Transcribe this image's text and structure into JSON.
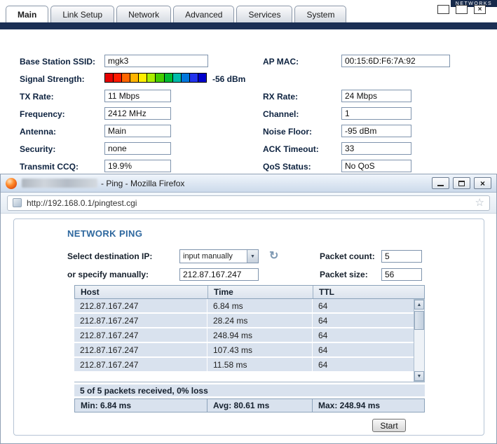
{
  "brand": {
    "logo_text": "NETWORKS"
  },
  "tabs": [
    {
      "label": "Main",
      "active": true
    },
    {
      "label": "Link Setup"
    },
    {
      "label": "Network"
    },
    {
      "label": "Advanced"
    },
    {
      "label": "Services"
    },
    {
      "label": "System"
    }
  ],
  "status": {
    "ssid": {
      "label": "Base Station SSID:",
      "value": "mgk3"
    },
    "ap_mac": {
      "label": "AP MAC:",
      "value": "00:15:6D:F6:7A:92"
    },
    "signal": {
      "label": "Signal Strength:",
      "value": "-56 dBm",
      "colors": [
        "#e60000",
        "#ff1a00",
        "#ff6600",
        "#ffb300",
        "#ffee00",
        "#aaee00",
        "#44cc00",
        "#00bb33",
        "#00bbaa",
        "#0077dd",
        "#2233ee",
        "#0000cc"
      ]
    },
    "tx_rate": {
      "label": "TX Rate:",
      "value": "11 Mbps"
    },
    "rx_rate": {
      "label": "RX Rate:",
      "value": "24 Mbps"
    },
    "frequency": {
      "label": "Frequency:",
      "value": "2412 MHz"
    },
    "channel": {
      "label": "Channel:",
      "value": "1"
    },
    "antenna": {
      "label": "Antenna:",
      "value": "Main"
    },
    "noise_floor": {
      "label": "Noise Floor:",
      "value": "-95 dBm"
    },
    "security": {
      "label": "Security:",
      "value": "none"
    },
    "ack_timeout": {
      "label": "ACK Timeout:",
      "value": "33"
    },
    "transmit_ccq": {
      "label": "Transmit CCQ:",
      "value": "19.9%"
    },
    "qos_status": {
      "label": "QoS Status:",
      "value": "No QoS"
    }
  },
  "firefox": {
    "title": "- Ping - Mozilla Firefox",
    "url": "http://192.168.0.1/pingtest.cgi",
    "ping": {
      "heading": "NETWORK PING",
      "dest_label": "Select destination IP:",
      "dest_value": "input manually",
      "manual_label": "or specify manually:",
      "manual_value": "212.87.167.247",
      "packet_count_label": "Packet count:",
      "packet_count_value": "5",
      "packet_size_label": "Packet size:",
      "packet_size_value": "56",
      "table": {
        "headers": [
          "Host",
          "Time",
          "TTL"
        ],
        "rows": [
          [
            "212.87.167.247",
            "6.84 ms",
            "64"
          ],
          [
            "212.87.167.247",
            "28.24 ms",
            "64"
          ],
          [
            "212.87.167.247",
            "248.94 ms",
            "64"
          ],
          [
            "212.87.167.247",
            "107.43 ms",
            "64"
          ],
          [
            "212.87.167.247",
            "11.58 ms",
            "64"
          ]
        ]
      },
      "summary": "5 of 5 packets received, 0% loss",
      "stats": {
        "min": "Min: 6.84 ms",
        "avg": "Avg: 80.61 ms",
        "max": "Max: 248.94 ms"
      },
      "start_label": "Start"
    }
  },
  "icons": {
    "chevron_down": "▼",
    "scroll_up": "▲",
    "scroll_down": "▼",
    "star": "☆",
    "refresh": "↻",
    "close": "×"
  }
}
